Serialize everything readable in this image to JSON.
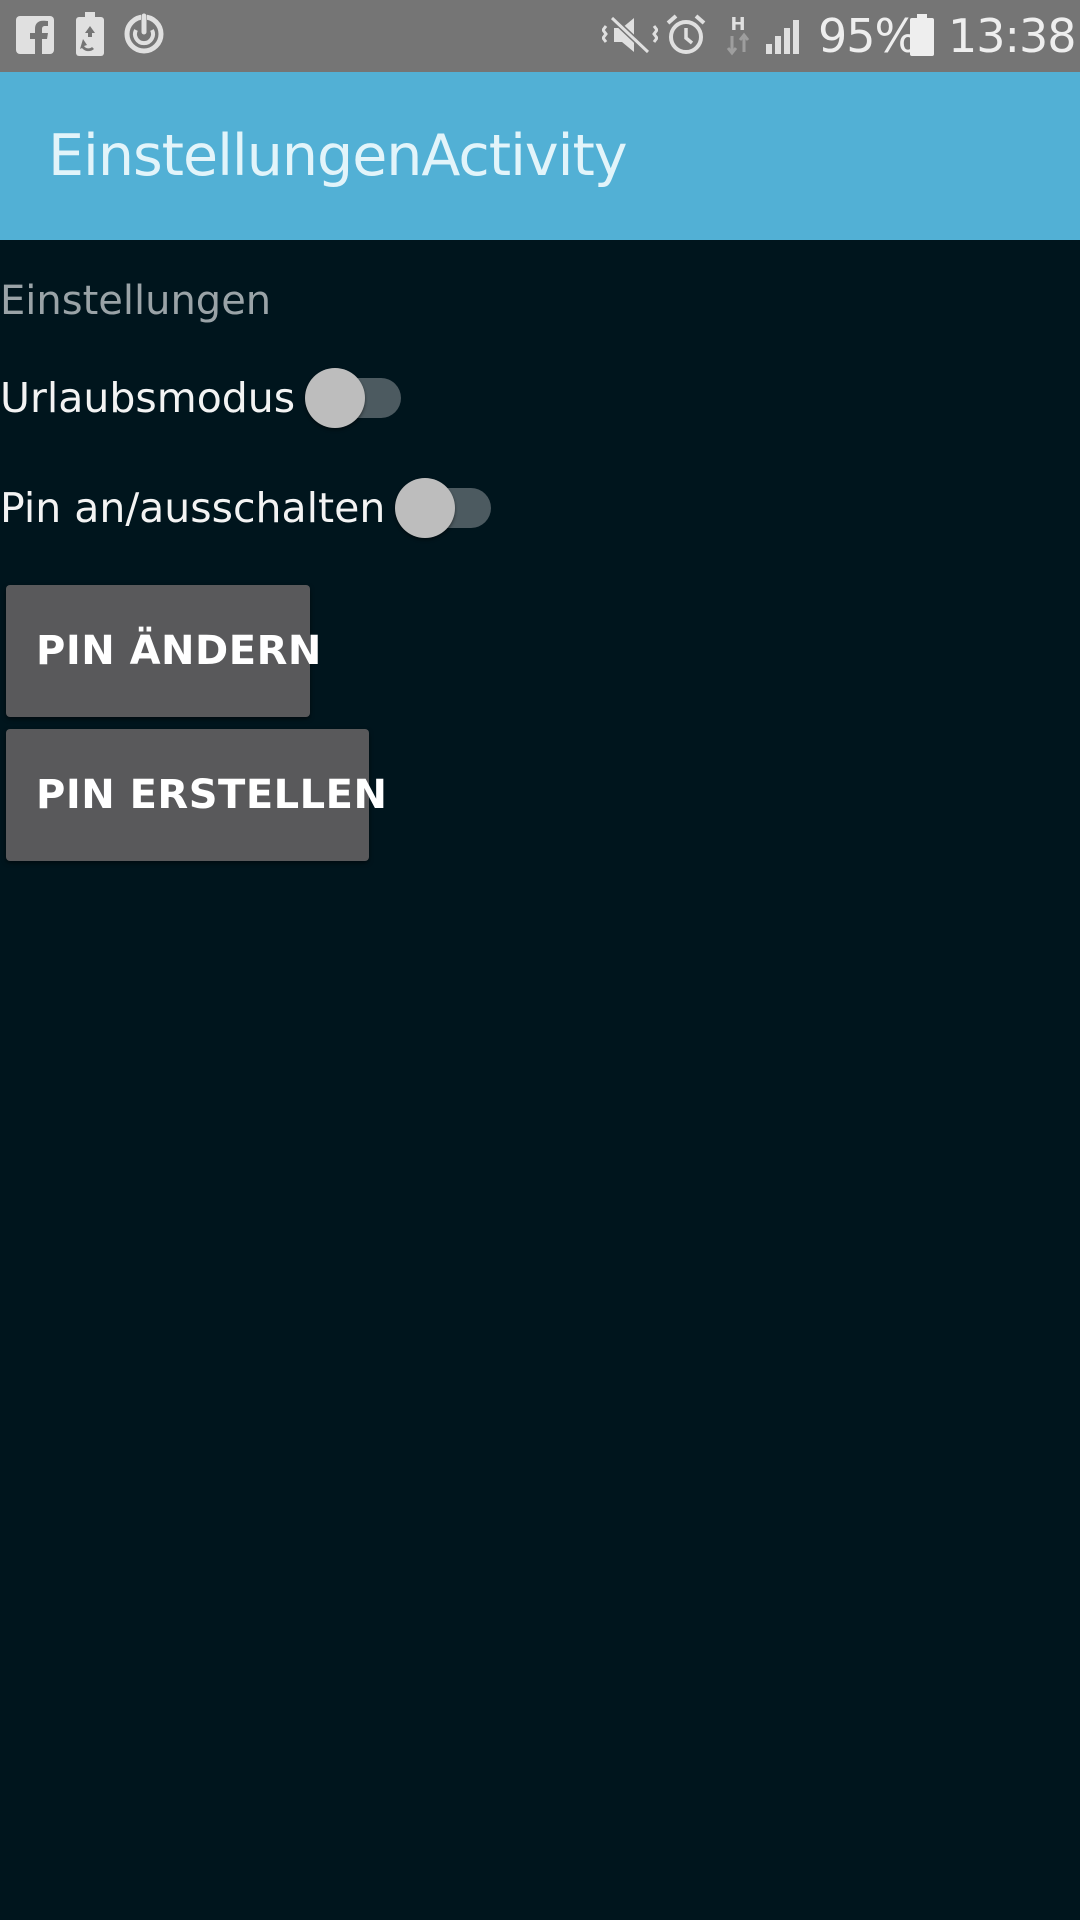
{
  "status_bar": {
    "left_icons": [
      "facebook-icon",
      "battery-saver-icon",
      "sync-icon"
    ],
    "right_icons": [
      "mute-vibrate-icon",
      "alarm-icon",
      "hsdpa-data-icon",
      "signal-icon",
      "battery-icon"
    ],
    "battery_percent": "95%",
    "time": "13:38"
  },
  "app_bar": {
    "title": "EinstellungenActivity",
    "color": "#52b0d5"
  },
  "settings": {
    "section_label": "Einstellungen",
    "vacation_mode": {
      "label": "Urlaubsmodus",
      "checked": false
    },
    "pin_toggle": {
      "label": "Pin an/ausschalten",
      "checked": false
    },
    "change_pin_label": "PIN ÄNDERN",
    "create_pin_label": "PIN ERSTELLEN"
  },
  "colors": {
    "background": "#00151d",
    "status_bar": "#757575",
    "button": "#59595b"
  }
}
